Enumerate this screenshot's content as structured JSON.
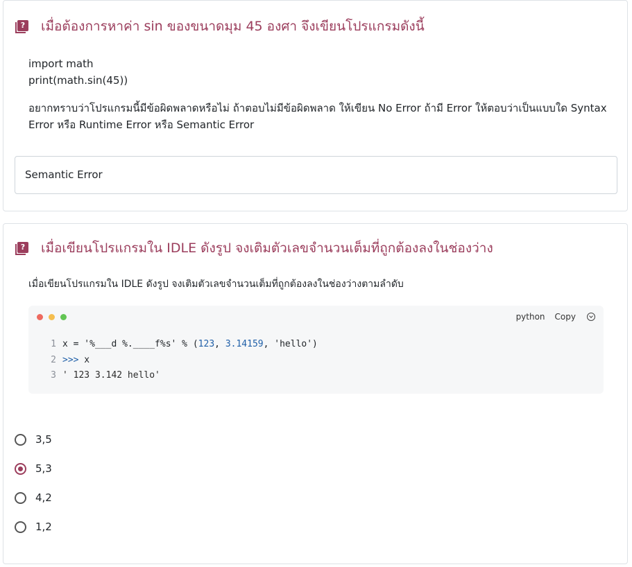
{
  "question1": {
    "title": "เมื่อต้องการหาค่า sin ของขนาดมุม 45 องศา จึงเขียนโปรแกรมดังนี้",
    "code_line1": "import math",
    "code_line2": "print(math.sin(45))",
    "prompt_line1": "อยากทราบว่าโปรแกรมนี้มีข้อผิดพลาดหรือไม่ ถ้าตอบไม่มีข้อผิดพลาด ให้เขียน No Error ถ้ามี Error ให้ตอบว่าเป็นแบบใด Syntax",
    "prompt_line2": "Error หรือ Runtime Error หรือ Semantic Error",
    "answer_value": "Semantic Error"
  },
  "question2": {
    "title": "เมื่อเขียนโปรแกรมใน IDLE ดังรูป จงเติมตัวเลขจำนวนเต็มที่ถูกต้องลงในช่องว่าง",
    "prompt": "เมื่อเขียนโปรแกรมใน IDLE ดังรูป จงเติมตัวเลขจำนวนเต็มที่ถูกต้องลงในช่องว่างตามลำดับ",
    "code_block": {
      "language": "python",
      "copy_label": "Copy",
      "window_dot_colors": [
        "#ee6a5f",
        "#f5be4f",
        "#62c554"
      ],
      "lines": [
        {
          "num": "1",
          "p1": "x = '%___d %.____f%s' % (",
          "n1": "123",
          "p2": ", ",
          "n2": "3.14159",
          "p3": ", 'hello')"
        },
        {
          "num": "2",
          "prompt": ">>>",
          "text": " x"
        },
        {
          "num": "3",
          "text": "'  123 3.142 hello'"
        }
      ]
    },
    "options": [
      "3,5",
      "5,3",
      "4,2",
      "1,2"
    ],
    "selected_option": "5,3"
  },
  "colors": {
    "accent": "#9b3d5c",
    "border": "#dee2e6",
    "code_bg": "#f6f7f8",
    "number_token": "#1f5fa8"
  }
}
